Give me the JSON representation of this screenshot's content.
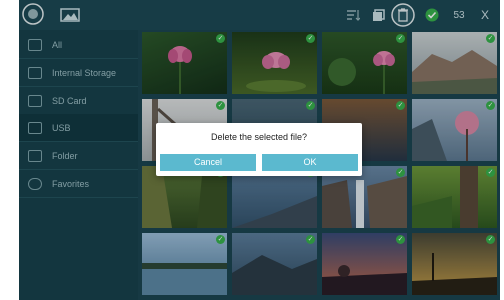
{
  "toolbar": {
    "selected_count": "53",
    "close_label": "X",
    "icons": [
      "camera-icon",
      "image-icon",
      "sort-icon",
      "copy-icon",
      "delete-icon",
      "select-all-icon"
    ]
  },
  "sidebar": {
    "items": [
      {
        "label": "All",
        "icon": "grid-icon"
      },
      {
        "label": "Internal Storage",
        "icon": "storage-icon"
      },
      {
        "label": "SD Card",
        "icon": "sd-card-icon"
      },
      {
        "label": "USB",
        "icon": "usb-icon"
      },
      {
        "label": "Folder",
        "icon": "folder-icon"
      },
      {
        "label": "Favorites",
        "icon": "heart-icon"
      }
    ]
  },
  "dialog": {
    "message": "Delete the selected file?",
    "cancel_label": "Cancel",
    "ok_label": "OK"
  },
  "colors": {
    "background": "#1c4652",
    "accent": "#5bb9cf",
    "check": "#37b24d"
  }
}
